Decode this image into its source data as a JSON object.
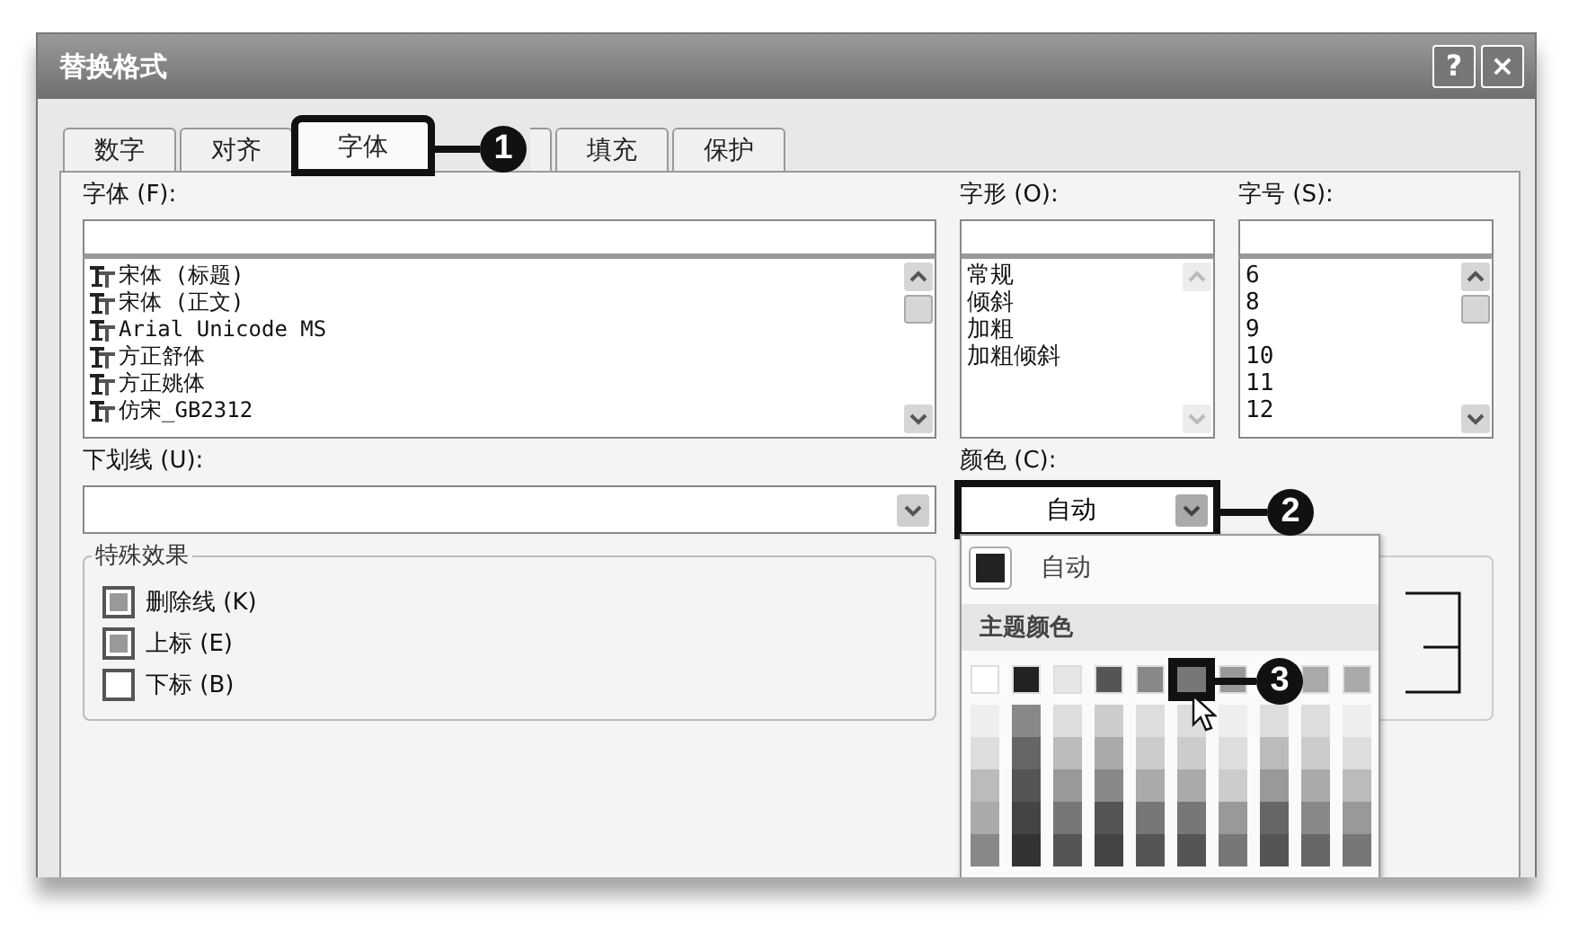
{
  "window": {
    "title": "替换格式",
    "buttons": [
      "?",
      "×"
    ]
  },
  "tabs": [
    {
      "label": "数字",
      "selected": false
    },
    {
      "label": "对齐",
      "selected": false
    },
    {
      "label": "字体",
      "selected": true,
      "callout": "1"
    },
    {
      "selected": false
    },
    {
      "label": "填充",
      "selected": false
    },
    {
      "label": "保护",
      "selected": false
    }
  ],
  "font": {
    "label": "字体 (F):",
    "items": [
      "宋体 (标题)",
      "宋体 (正文)",
      "Arial Unicode MS",
      "方正舒体",
      "方正姚体",
      "仿宋_GB2312"
    ]
  },
  "style": {
    "label": "字形 (O):",
    "items": [
      "常规",
      "倾斜",
      "加粗",
      "加粗倾斜"
    ]
  },
  "size": {
    "label": "字号 (S):",
    "items": [
      "6",
      "8",
      "9",
      "10",
      "11",
      "12"
    ]
  },
  "underline": {
    "label": "下划线 (U):"
  },
  "color": {
    "label": "颜色 (C):",
    "value": "自动",
    "callout": "2"
  },
  "effects": {
    "title": "特殊效果",
    "items": [
      {
        "label": "删除线 (K)",
        "indeterminate": true
      },
      {
        "label": "上标 (E)",
        "indeterminate": true
      },
      {
        "label": "下标 (B)",
        "indeterminate": false
      }
    ]
  },
  "color_menu": {
    "automatic": {
      "label": "自动",
      "color": "#222222"
    },
    "theme_title": "主题颜色",
    "theme_colors": [
      {
        "color": "#ffffff",
        "selected": false,
        "shades": [
          {
            "color": "#eeeeee"
          },
          {
            "color": "#dddddd"
          },
          {
            "color": "#bbbbbb"
          },
          {
            "color": "#aaaaaa"
          },
          {
            "color": "#888888"
          }
        ]
      },
      {
        "color": "#222222",
        "selected": false,
        "shades": [
          {
            "color": "#888888"
          },
          {
            "color": "#666666"
          },
          {
            "color": "#555555"
          },
          {
            "color": "#444444"
          },
          {
            "color": "#333333"
          }
        ]
      },
      {
        "color": "#e6e6e6",
        "selected": false,
        "shades": [
          {
            "color": "#dddddd"
          },
          {
            "color": "#bbbbbb"
          },
          {
            "color": "#999999"
          },
          {
            "color": "#777777"
          },
          {
            "color": "#555555"
          }
        ]
      },
      {
        "color": "#555555",
        "selected": false,
        "shades": [
          {
            "color": "#cccccc"
          },
          {
            "color": "#aaaaaa"
          },
          {
            "color": "#888888"
          },
          {
            "color": "#555555"
          },
          {
            "color": "#444444"
          }
        ]
      },
      {
        "color": "#888888",
        "selected": false,
        "shades": [
          {
            "color": "#dddddd"
          },
          {
            "color": "#cccccc"
          },
          {
            "color": "#aaaaaa"
          },
          {
            "color": "#777777"
          },
          {
            "color": "#555555"
          }
        ]
      },
      {
        "color": "#777777",
        "selected": true,
        "callout": "3",
        "shades": [
          {
            "color": "#dddddd"
          },
          {
            "color": "#cccccc"
          },
          {
            "color": "#aaaaaa"
          },
          {
            "color": "#777777"
          },
          {
            "color": "#555555"
          }
        ]
      },
      {
        "color": "#999999",
        "selected": false,
        "shades": [
          {
            "color": "#eeeeee"
          },
          {
            "color": "#dddddd"
          },
          {
            "color": "#cccccc"
          },
          {
            "color": "#999999"
          },
          {
            "color": "#777777"
          }
        ]
      },
      {
        "shades": [
          {
            "color": "#dddddd"
          },
          {
            "color": "#bbbbbb"
          },
          {
            "color": "#999999"
          },
          {
            "color": "#666666"
          },
          {
            "color": "#555555"
          }
        ]
      },
      {
        "color": "#aaaaaa",
        "selected": false,
        "shades": [
          {
            "color": "#dddddd"
          },
          {
            "color": "#cccccc"
          },
          {
            "color": "#aaaaaa"
          },
          {
            "color": "#888888"
          },
          {
            "color": "#666666"
          }
        ]
      },
      {
        "color": "#aaaaaa",
        "selected": false,
        "shades": [
          {
            "color": "#eeeeee"
          },
          {
            "color": "#dddddd"
          },
          {
            "color": "#bbbbbb"
          },
          {
            "color": "#999999"
          },
          {
            "color": "#777777"
          }
        ]
      }
    ]
  }
}
